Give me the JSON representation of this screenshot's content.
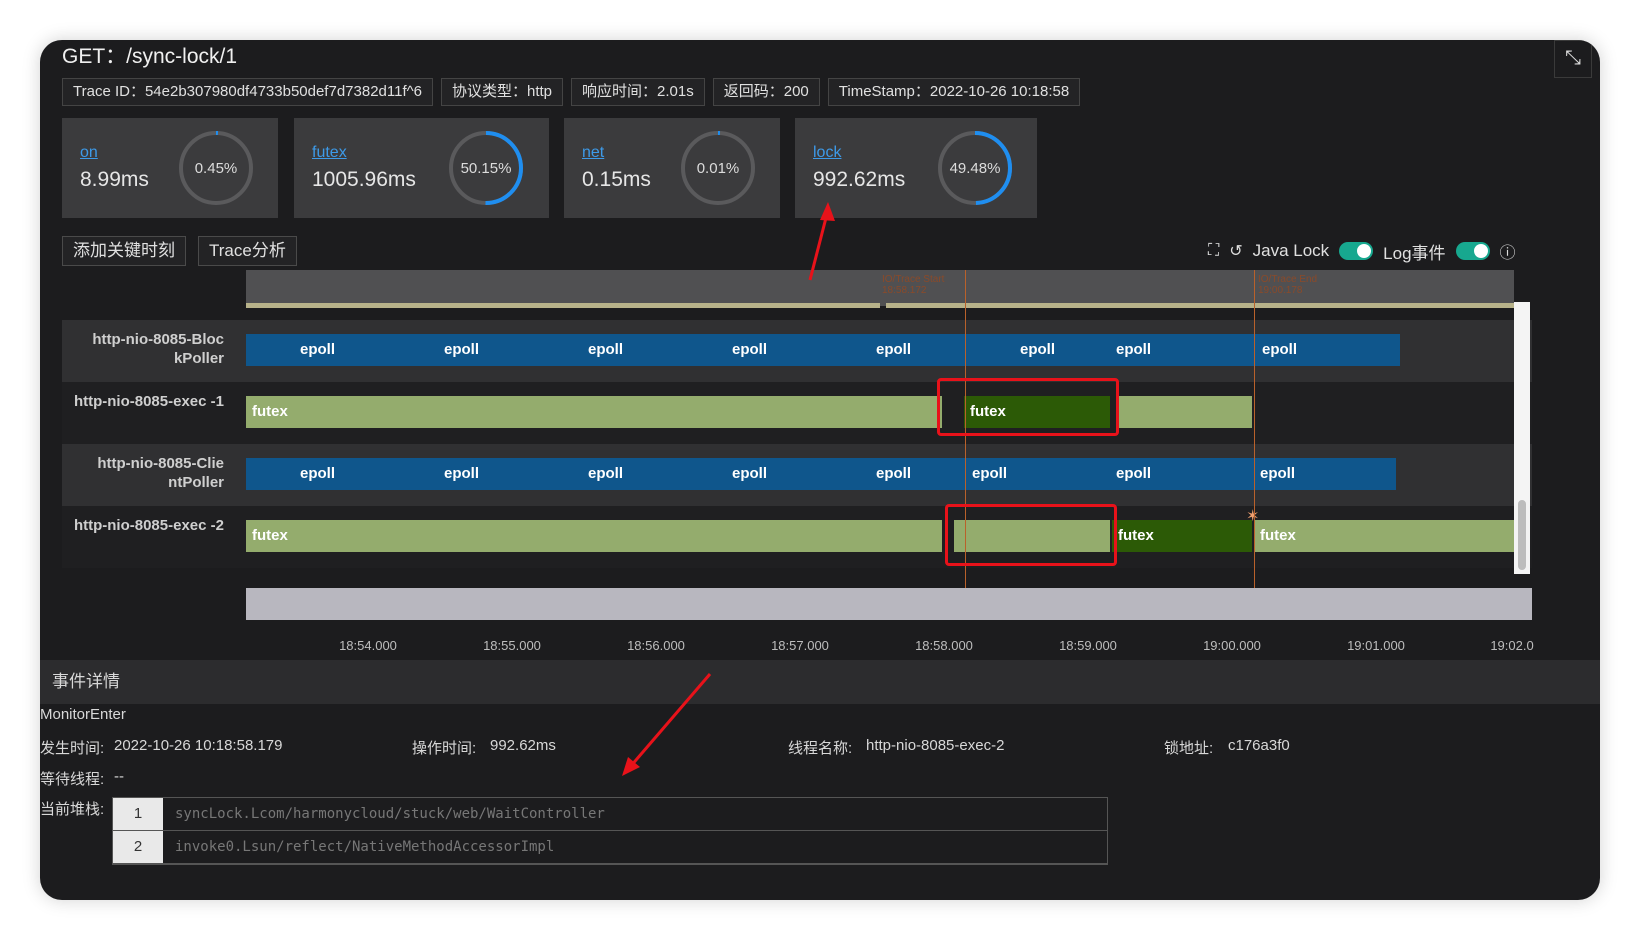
{
  "header": {
    "title": "GET：/sync-lock/1"
  },
  "chips": [
    "Trace ID：54e2b307980df4733b50def7d7382d11f^6",
    "协议类型：http",
    "响应时间：2.01s",
    "返回码：200",
    "TimeStamp：2022-10-26 10:18:58"
  ],
  "cards": [
    {
      "name": "on",
      "value": "8.99ms",
      "percent": "0.45%",
      "fraction": 0.0045
    },
    {
      "name": "futex",
      "value": "1005.96ms",
      "percent": "50.15%",
      "fraction": 0.5015
    },
    {
      "name": "net",
      "value": "0.15ms",
      "percent": "0.01%",
      "fraction": 0.0001
    },
    {
      "name": "lock",
      "value": "992.62ms",
      "percent": "49.48%",
      "fraction": 0.4948
    }
  ],
  "toolbar": {
    "add_key_time": "添加关键时刻",
    "trace_analysis": "Trace分析",
    "java_lock": "Java Lock",
    "log_event": "Log事件"
  },
  "markers": {
    "start": "IO/Trace Start 18:58.172",
    "end": "IO/Trace End 19:00.178"
  },
  "threads": [
    {
      "label": "http-nio-8085-Bloc kPoller",
      "segment": "epoll"
    },
    {
      "label": "http-nio-8085-exec -1",
      "segment": "futex"
    },
    {
      "label": "http-nio-8085-Clie ntPoller",
      "segment": "epoll"
    },
    {
      "label": "http-nio-8085-exec -2",
      "segment": "futex"
    }
  ],
  "axis_ticks": [
    "18:54.000",
    "18:55.000",
    "18:56.000",
    "18:57.000",
    "18:58.000",
    "18:59.000",
    "19:00.000",
    "19:01.000",
    "19:02.0"
  ],
  "details": {
    "header": "事件详情",
    "event_type": "MonitorEnter",
    "occur_label": "发生时间:",
    "occur_value": "2022-10-26 10:18:58.179",
    "op_label": "操作时间:",
    "op_value": "992.62ms",
    "thread_label": "线程名称:",
    "thread_value": "http-nio-8085-exec-2",
    "lock_label": "锁地址:",
    "lock_value": "c176a3f0",
    "wait_label": "等待线程:",
    "wait_value": "--",
    "stack_label": "当前堆栈:",
    "stack": [
      {
        "num": "1",
        "text": "syncLock.Lcom/harmonycloud/stuck/web/WaitController"
      },
      {
        "num": "2",
        "text": "invoke0.Lsun/reflect/NativeMethodAccessorImpl"
      }
    ]
  },
  "colors": {
    "accent": "#3d9ae8",
    "toggle": "#17a88f",
    "epoll": "#0f568c",
    "futex": "#94ac6d",
    "futex_active": "#2c5a06",
    "highlight": "#e8121a"
  }
}
